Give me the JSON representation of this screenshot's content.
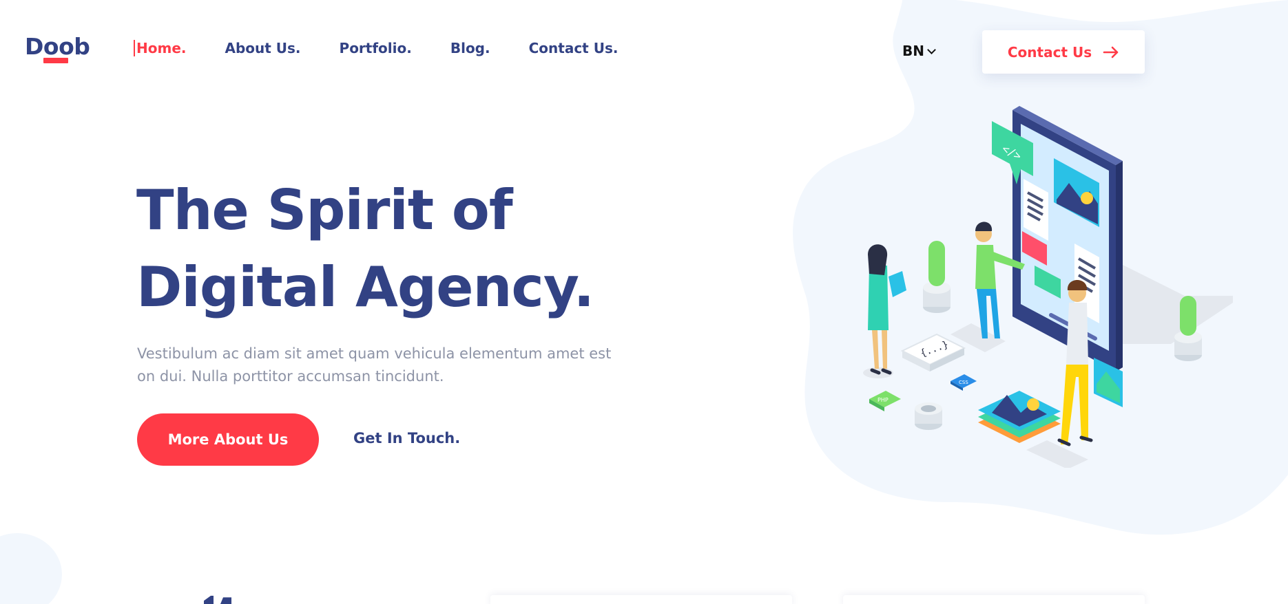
{
  "header": {
    "logo_text": "Doob",
    "nav": [
      {
        "label": "Home.",
        "active": true
      },
      {
        "label": "About Us.",
        "active": false
      },
      {
        "label": "Portfolio.",
        "active": false
      },
      {
        "label": "Blog.",
        "active": false
      },
      {
        "label": "Contact Us.",
        "active": false
      }
    ],
    "language": "BN",
    "contact_button": "Contact Us"
  },
  "hero": {
    "title_line1": "The Spirit of",
    "title_line2": "Digital Agency.",
    "description": "Vestibulum ac diam sit amet quam vehicula elementum amet est on dui. Nulla porttitor accumsan tincidunt.",
    "primary_button": "More About Us",
    "secondary_link": "Get In Touch."
  },
  "illustration": {
    "code_tag": "</>",
    "braces_label": "{...}",
    "chip_php": "PHP",
    "chip_css": "CSS"
  },
  "colors": {
    "primary": "#324284",
    "accent": "#ff3a46",
    "muted_text": "#8d93a6",
    "blob": "#f2f7fd"
  }
}
